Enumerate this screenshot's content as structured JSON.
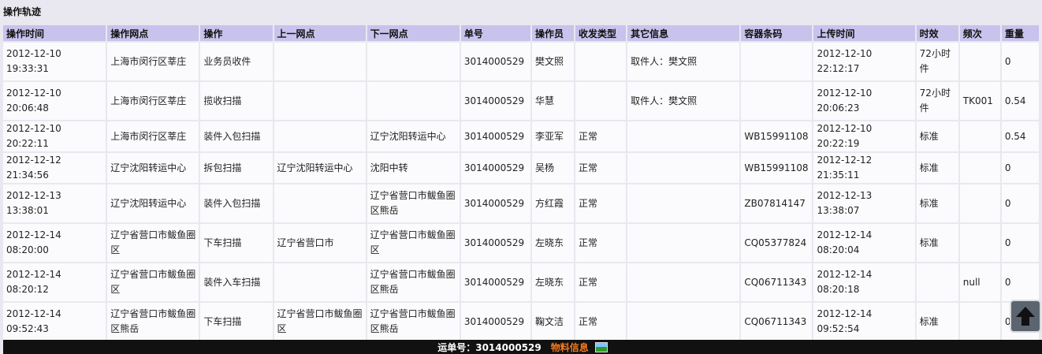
{
  "page": {
    "section_title": "操作轨迹"
  },
  "table": {
    "headers": [
      "操作时间",
      "操作网点",
      "操作",
      "上一网点",
      "下一网点",
      "单号",
      "操作员",
      "收发类型",
      "其它信息",
      "容器条码",
      "上传时间",
      "时效",
      "频次",
      "重量"
    ],
    "rows": [
      [
        "2012-12-10 19:33:31",
        "上海市闵行区莘庄",
        "业务员收件",
        "",
        "",
        "3014000529",
        "樊文照",
        "",
        "取件人：樊文照",
        "",
        "2012-12-10 22:12:17",
        "72小时件",
        "",
        "0"
      ],
      [
        "2012-12-10 20:06:48",
        "上海市闵行区莘庄",
        "揽收扫描",
        "",
        "",
        "3014000529",
        "华慧",
        "",
        "取件人：樊文照",
        "",
        "2012-12-10 20:06:23",
        "72小时件",
        "TK001",
        "0.54"
      ],
      [
        "2012-12-10 20:22:11",
        "上海市闵行区莘庄",
        "装件入包扫描",
        "",
        "辽宁沈阳转运中心",
        "3014000529",
        "李亚军",
        "正常",
        "",
        "WB15991108",
        "2012-12-10 20:22:19",
        "标准",
        "",
        "0.54"
      ],
      [
        "2012-12-12 21:34:56",
        "辽宁沈阳转运中心",
        "拆包扫描",
        "辽宁沈阳转运中心",
        "沈阳中转",
        "3014000529",
        "吴杨",
        "正常",
        "",
        "WB15991108",
        "2012-12-12 21:35:11",
        "标准",
        "",
        "0"
      ],
      [
        "2012-12-13 13:38:01",
        "辽宁沈阳转运中心",
        "装件入包扫描",
        "",
        "辽宁省营口市鲅鱼圈区熊岳",
        "3014000529",
        "方红霞",
        "正常",
        "",
        "ZB07814147",
        "2012-12-13 13:38:07",
        "标准",
        "",
        "0"
      ],
      [
        "2012-12-14 08:20:00",
        "辽宁省营口市鲅鱼圈区",
        "下车扫描",
        "辽宁省营口市",
        "辽宁省营口市鲅鱼圈区",
        "3014000529",
        "左晓东",
        "正常",
        "",
        "CQ05377824",
        "2012-12-14 08:20:04",
        "标准",
        "",
        "0"
      ],
      [
        "2012-12-14 08:20:12",
        "辽宁省营口市鲅鱼圈区",
        "装件入车扫描",
        "",
        "辽宁省营口市鲅鱼圈区熊岳",
        "3014000529",
        "左晓东",
        "正常",
        "",
        "CQ06711343",
        "2012-12-14 08:20:18",
        "",
        "null",
        "0"
      ],
      [
        "2012-12-14 09:52:43",
        "辽宁省营口市鲅鱼圈区熊岳",
        "下车扫描",
        "辽宁省营口市鲅鱼圈区",
        "辽宁省营口市鲅鱼圈区熊岳",
        "3014000529",
        "鞠文洁",
        "正常",
        "",
        "CQ06711343",
        "2012-12-14 09:52:54",
        "标准",
        "",
        "0"
      ]
    ]
  },
  "footer": {
    "waybill_label": "运单号：3014000529",
    "material_link": "物料信息",
    "material_icon": "image-icon"
  },
  "scroll_top": {
    "icon": "arrow-up-icon"
  },
  "colors": {
    "header_bg": "#c7c3ec",
    "page_bg": "#e9e8f0",
    "cell_bg": "#fbfbfd",
    "footer_bg": "#111111",
    "link_orange": "#f47a1f"
  }
}
